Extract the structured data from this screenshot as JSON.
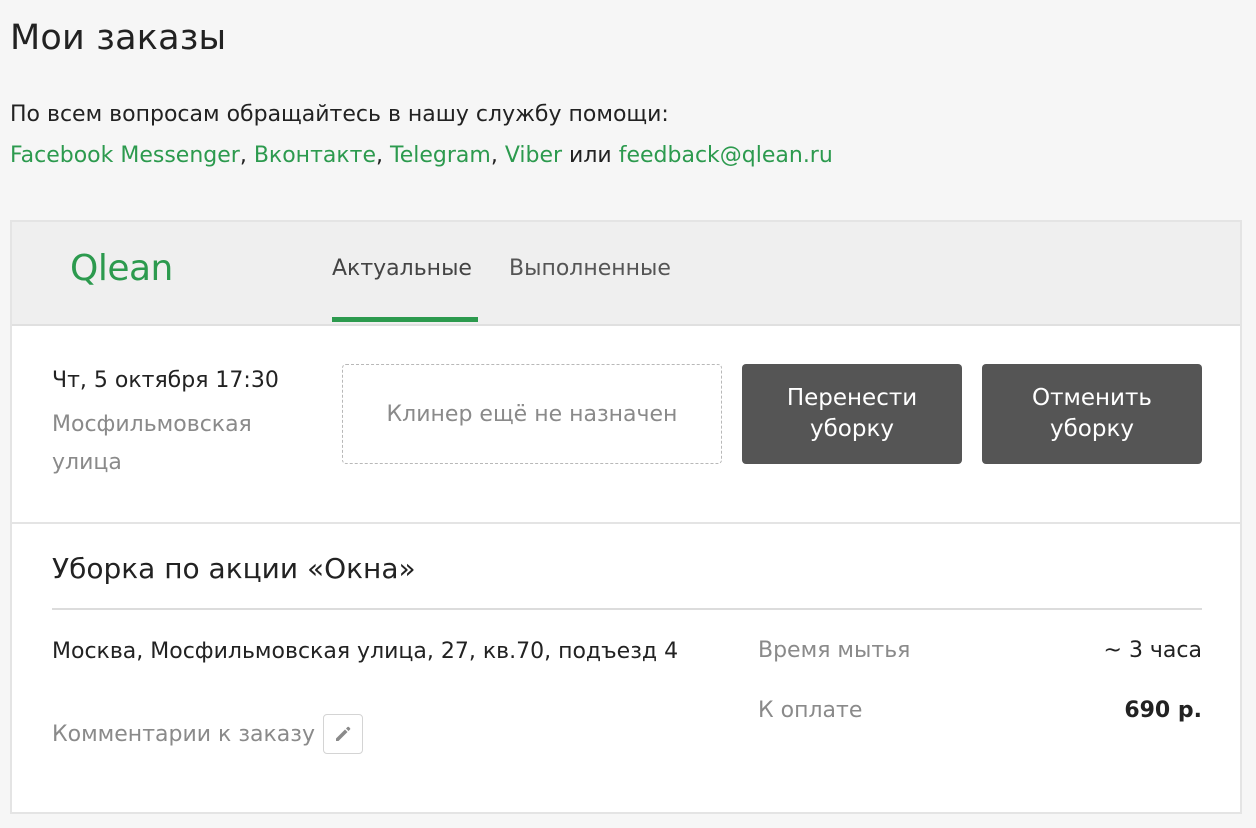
{
  "page": {
    "title": "Мои заказы"
  },
  "help": {
    "intro": "По всем вопросам обращайтесь в нашу службу помощи:",
    "links": {
      "facebook": "Facebook Messenger",
      "vk": "Вконтакте",
      "telegram": "Telegram",
      "viber": "Viber",
      "email": "feedback@qlean.ru"
    },
    "sep1": ", ",
    "sep2": ", ",
    "sep3": ", ",
    "or": " или "
  },
  "header": {
    "logo": "Qlean",
    "tabs": [
      {
        "label": "Актуальные",
        "active": true
      },
      {
        "label": "Выполненные",
        "active": false
      }
    ]
  },
  "order": {
    "date": "Чт, 5 октября 17:30",
    "street": "Мосфильмовская улица",
    "cleaner_status": "Клинер ещё не назначен",
    "reschedule_label": "Перенести уборку",
    "cancel_label": "Отменить уборку",
    "service_title": "Уборка по акции «Окна»",
    "address": "Москва, Мосфильмовская улица, 27, кв.70, подъезд 4",
    "comments_label": "Комментарии к заказу",
    "details": {
      "time_label": "Время мытья",
      "time_value": "~ 3 часа",
      "pay_label": "К оплате",
      "pay_value": "690 р."
    }
  },
  "colors": {
    "accent": "#2c9a4e",
    "button": "#555555",
    "muted_text": "#8a8a8a"
  },
  "icons": {
    "edit": "pencil-icon"
  }
}
